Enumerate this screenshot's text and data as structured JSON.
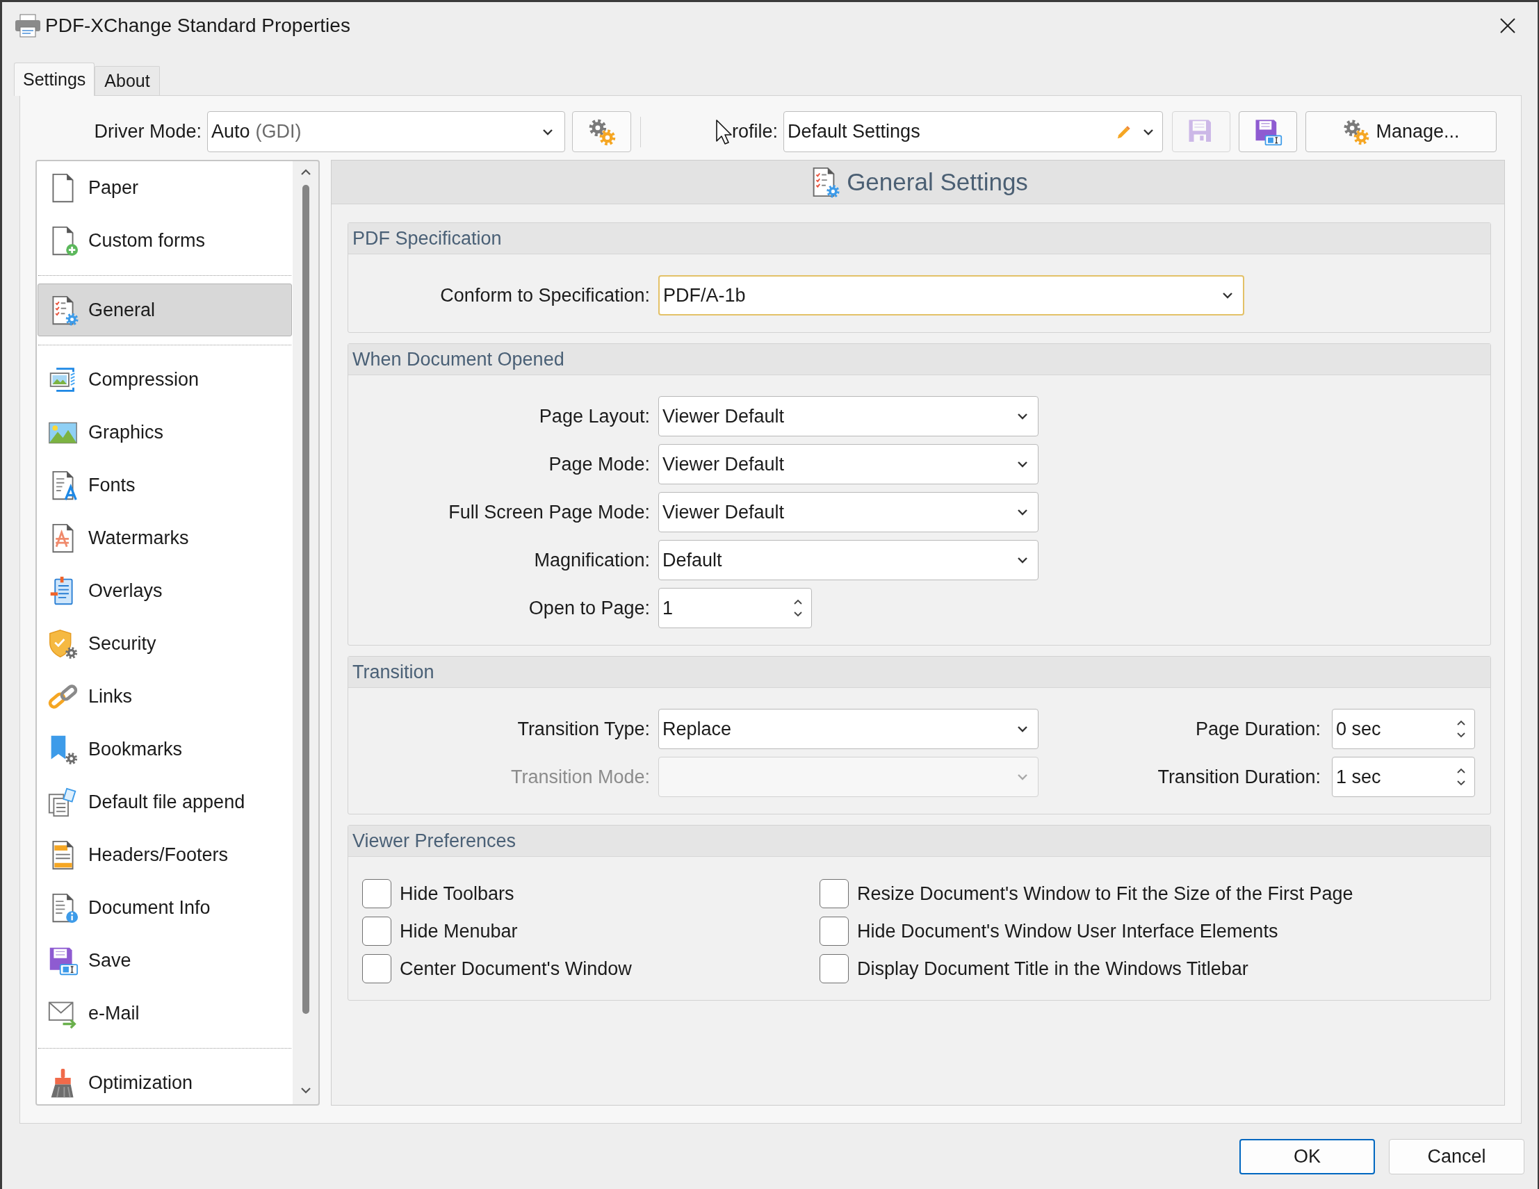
{
  "window": {
    "title": "PDF-XChange Standard Properties"
  },
  "tabs": [
    {
      "label": "Settings",
      "selected": true
    },
    {
      "label": "About",
      "selected": false
    }
  ],
  "toolbar": {
    "driver_mode": {
      "label": "Driver Mode:",
      "value": "Auto",
      "note": "(GDI)"
    },
    "profile": {
      "label": "rofile:",
      "value": "Default Settings"
    },
    "save_buttons": [
      {
        "disabled": true
      },
      {
        "disabled": false
      }
    ],
    "manage_button": {
      "label": "Manage..."
    }
  },
  "sidebar": {
    "groups": [
      {
        "items": [
          {
            "label": "Paper",
            "selected": false
          },
          {
            "label": "Custom forms",
            "selected": false
          }
        ]
      },
      {
        "items": [
          {
            "label": "General",
            "selected": true
          }
        ]
      },
      {
        "items": [
          {
            "label": "Compression",
            "selected": false
          },
          {
            "label": "Graphics",
            "selected": false
          },
          {
            "label": "Fonts",
            "selected": false
          },
          {
            "label": "Watermarks",
            "selected": false
          },
          {
            "label": "Overlays",
            "selected": false
          },
          {
            "label": "Security",
            "selected": false
          },
          {
            "label": "Links",
            "selected": false
          },
          {
            "label": "Bookmarks",
            "selected": false
          },
          {
            "label": "Default file append",
            "selected": false
          },
          {
            "label": "Headers/Footers",
            "selected": false
          },
          {
            "label": "Document Info",
            "selected": false
          },
          {
            "label": "Save",
            "selected": false
          },
          {
            "label": "e-Mail",
            "selected": false
          }
        ]
      },
      {
        "items": [
          {
            "label": "Optimization",
            "selected": false
          }
        ]
      }
    ]
  },
  "panel": {
    "title": "General Settings",
    "groups": [
      {
        "title": "PDF Specification",
        "columns": [
          [
            {
              "kind": "select",
              "label": "Conform to Specification:",
              "value": "PDF/A-1b",
              "focused": true,
              "disabled": false
            }
          ]
        ]
      },
      {
        "title": "When Document Opened",
        "columns": [
          [
            {
              "kind": "select",
              "label": "Page Layout:",
              "value": "Viewer Default",
              "focused": false,
              "disabled": false
            },
            {
              "kind": "select",
              "label": "Page Mode:",
              "value": "Viewer Default",
              "focused": false,
              "disabled": false
            },
            {
              "kind": "select",
              "label": "Full Screen Page Mode:",
              "value": "Viewer Default",
              "focused": false,
              "disabled": false
            },
            {
              "kind": "select",
              "label": "Magnification:",
              "value": "Default",
              "focused": false,
              "disabled": false
            },
            {
              "kind": "spin",
              "label": "Open to Page:",
              "value": "1",
              "focused": false,
              "disabled": false
            }
          ]
        ]
      },
      {
        "title": "Transition",
        "columns": [
          [
            {
              "kind": "select",
              "label": "Transition Type:",
              "value": "Replace",
              "focused": false,
              "disabled": false
            },
            {
              "kind": "select",
              "label": "Transition Mode:",
              "focused": false,
              "disabled": true
            }
          ],
          [
            {
              "kind": "spin",
              "label": "Page Duration:",
              "value": "0 sec",
              "focused": false,
              "disabled": false
            },
            {
              "kind": "spin",
              "label": "Transition Duration:",
              "value": "1 sec",
              "focused": false,
              "disabled": false
            }
          ]
        ]
      },
      {
        "title": "Viewer Preferences",
        "columns": [
          [
            {
              "kind": "checkbox",
              "label": "Hide Toolbars",
              "checked": false
            },
            {
              "kind": "checkbox",
              "label": "Hide Menubar",
              "checked": false
            },
            {
              "kind": "checkbox",
              "label": "Center Document's Window",
              "checked": false
            }
          ],
          [
            {
              "kind": "checkbox",
              "label": "Resize Document's Window to Fit the Size of the First Page",
              "checked": false
            },
            {
              "kind": "checkbox",
              "label": "Hide Document's Window User Interface Elements",
              "checked": false
            },
            {
              "kind": "checkbox",
              "label": "Display Document Title in the Windows Titlebar",
              "checked": false
            }
          ]
        ]
      }
    ]
  },
  "footer": {
    "buttons": [
      {
        "label": "OK",
        "default": true
      },
      {
        "label": "Cancel",
        "default": false
      }
    ]
  }
}
